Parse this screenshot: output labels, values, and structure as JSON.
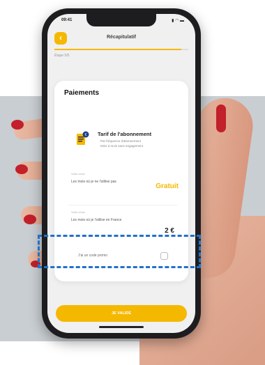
{
  "status_bar": {
    "time": "09:41",
    "icons": "▮ ◠ ▬"
  },
  "header": {
    "back_icon": "chevron-left-icon",
    "back_glyph": "‹",
    "title": "Récapitulatif"
  },
  "progress": {
    "value": 0.95,
    "step_label": "Étape 5/5"
  },
  "card": {
    "title": "Paiements",
    "tarif": {
      "title": "Tarif de l'abonnement",
      "lines": [
        "Par fréquence d'abonnement",
        "Mois à mois sans engagement"
      ]
    },
    "row1": {
      "small_label": "Votre choix",
      "text": "Les mois où je ne l'utilise pas",
      "value": "Gratuit"
    },
    "row2": {
      "small_label": "Votre choix",
      "text": "Les mois où je l'utilise en France",
      "value": "2 €"
    },
    "promo": {
      "text": "J'ai un code promo",
      "checked": false
    }
  },
  "validate_button": {
    "label": "JE VALIDE"
  },
  "colors": {
    "accent": "#f5b800",
    "highlight": "#1f72c8",
    "nail": "#c2202a"
  }
}
